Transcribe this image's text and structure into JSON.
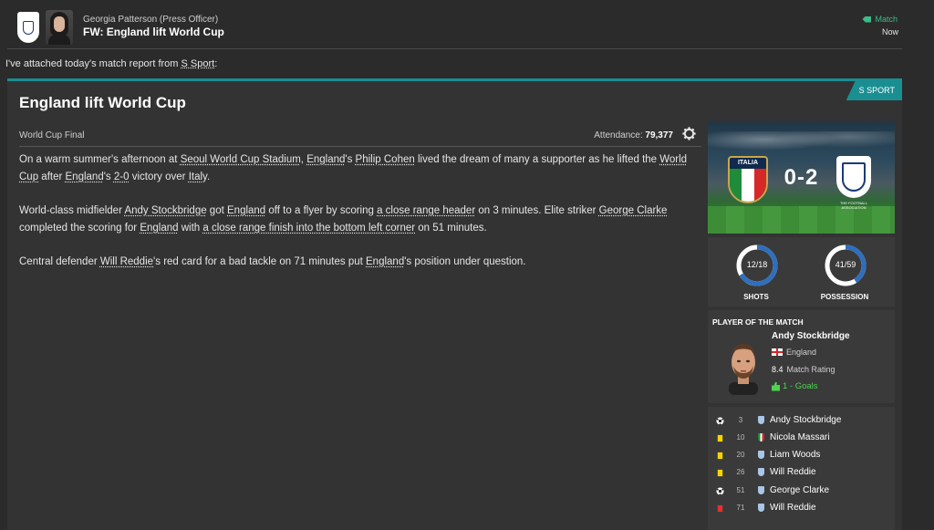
{
  "header": {
    "sender": "Georgia Patterson  (Press Officer)",
    "subject": "FW: England lift World Cup",
    "tag": "Match",
    "time": "Now"
  },
  "intro": {
    "text": "I've attached today's match report from ",
    "source": "S Sport",
    "suffix": ":"
  },
  "report": {
    "source_tab": "S SPORT",
    "title": "England lift World Cup",
    "competition": "World Cup Final",
    "attendance_label": "Attendance:",
    "attendance_value": "79,377",
    "para1": [
      "On a warm summer's afternoon at ",
      "Seoul World Cup Stadium",
      ", ",
      "England",
      "'s ",
      "Philip Cohen",
      " lived the dream of many a supporter as he lifted the ",
      "World Cup",
      " after ",
      "England",
      "'s ",
      "2-0",
      " victory over ",
      "Italy",
      "."
    ],
    "para2": [
      "World-class midfielder ",
      "Andy Stockbridge",
      " got ",
      "England",
      " off to a flyer by scoring ",
      "a close range header",
      " on 3 minutes. Elite striker ",
      "George Clarke",
      " completed the scoring for ",
      "England",
      " with ",
      "a close range finish into the bottom left corner",
      " on 51 minutes."
    ],
    "para3": [
      "Central defender ",
      "Will Reddie",
      "'s red card for a bad tackle on 71 minutes put ",
      "England",
      "'s position under question."
    ]
  },
  "scoreboard": {
    "home_label": "ITALIA",
    "score": "0-2",
    "away_caption": "THE FOOTBALL ASSOCIATION",
    "colors": {
      "pitch": "#3f8e3a",
      "ita_navy": "#0f2a4e",
      "ita_gold": "#c9a64a",
      "eng_blue": "#1d3a78"
    }
  },
  "stats": {
    "shots": {
      "label": "SHOTS",
      "value": "12/18",
      "ratio": 0.667
    },
    "possession": {
      "label": "POSSESSION",
      "value": "41/59",
      "ratio": 0.41
    },
    "ring_colors": {
      "home": "#2f6fbd",
      "away": "#ffffff"
    }
  },
  "potm": {
    "title": "PLAYER OF THE MATCH",
    "name": "Andy Stockbridge",
    "nation": "England",
    "rating": "8.4",
    "rating_label": "Match Rating",
    "goals": "1 - Goals"
  },
  "events": [
    {
      "type": "goal",
      "minute": "3",
      "team": "eng",
      "player": "Andy Stockbridge"
    },
    {
      "type": "yellow",
      "minute": "10",
      "team": "ita",
      "player": "Nicola Massari"
    },
    {
      "type": "yellow",
      "minute": "20",
      "team": "eng",
      "player": "Liam Woods"
    },
    {
      "type": "yellow",
      "minute": "26",
      "team": "eng",
      "player": "Will Reddie"
    },
    {
      "type": "goal",
      "minute": "51",
      "team": "eng",
      "player": "George Clarke"
    },
    {
      "type": "red",
      "minute": "71",
      "team": "eng",
      "player": "Will Reddie"
    }
  ]
}
